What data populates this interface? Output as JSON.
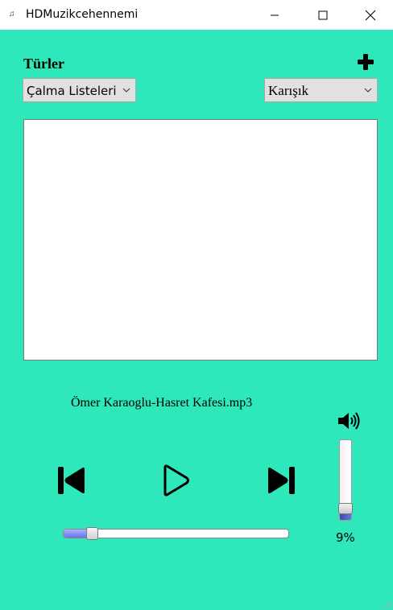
{
  "window": {
    "title": "HDMuzikcehennemi",
    "app_icon": "music-app-icon",
    "controls": [
      "minimize-icon",
      "maximize-icon",
      "close-icon"
    ]
  },
  "genres": {
    "label": "Türler",
    "add_icon": "plus-icon"
  },
  "playlists_select": {
    "value": "Çalma Listeleri"
  },
  "genre_select": {
    "value": "Karışık"
  },
  "song_list": {
    "items": []
  },
  "player": {
    "now_playing": "Ömer Karaoglu-Hasret Kafesi.mp3",
    "prev_icon": "skip-previous-icon",
    "play_icon": "play-icon",
    "next_icon": "skip-next-icon",
    "seek_position": 0.11
  },
  "volume": {
    "icon": "speaker-icon",
    "level": 0.09,
    "percent_label": "9%"
  },
  "colors": {
    "background": "#2ee8bb",
    "accent": "#6a72f0"
  }
}
